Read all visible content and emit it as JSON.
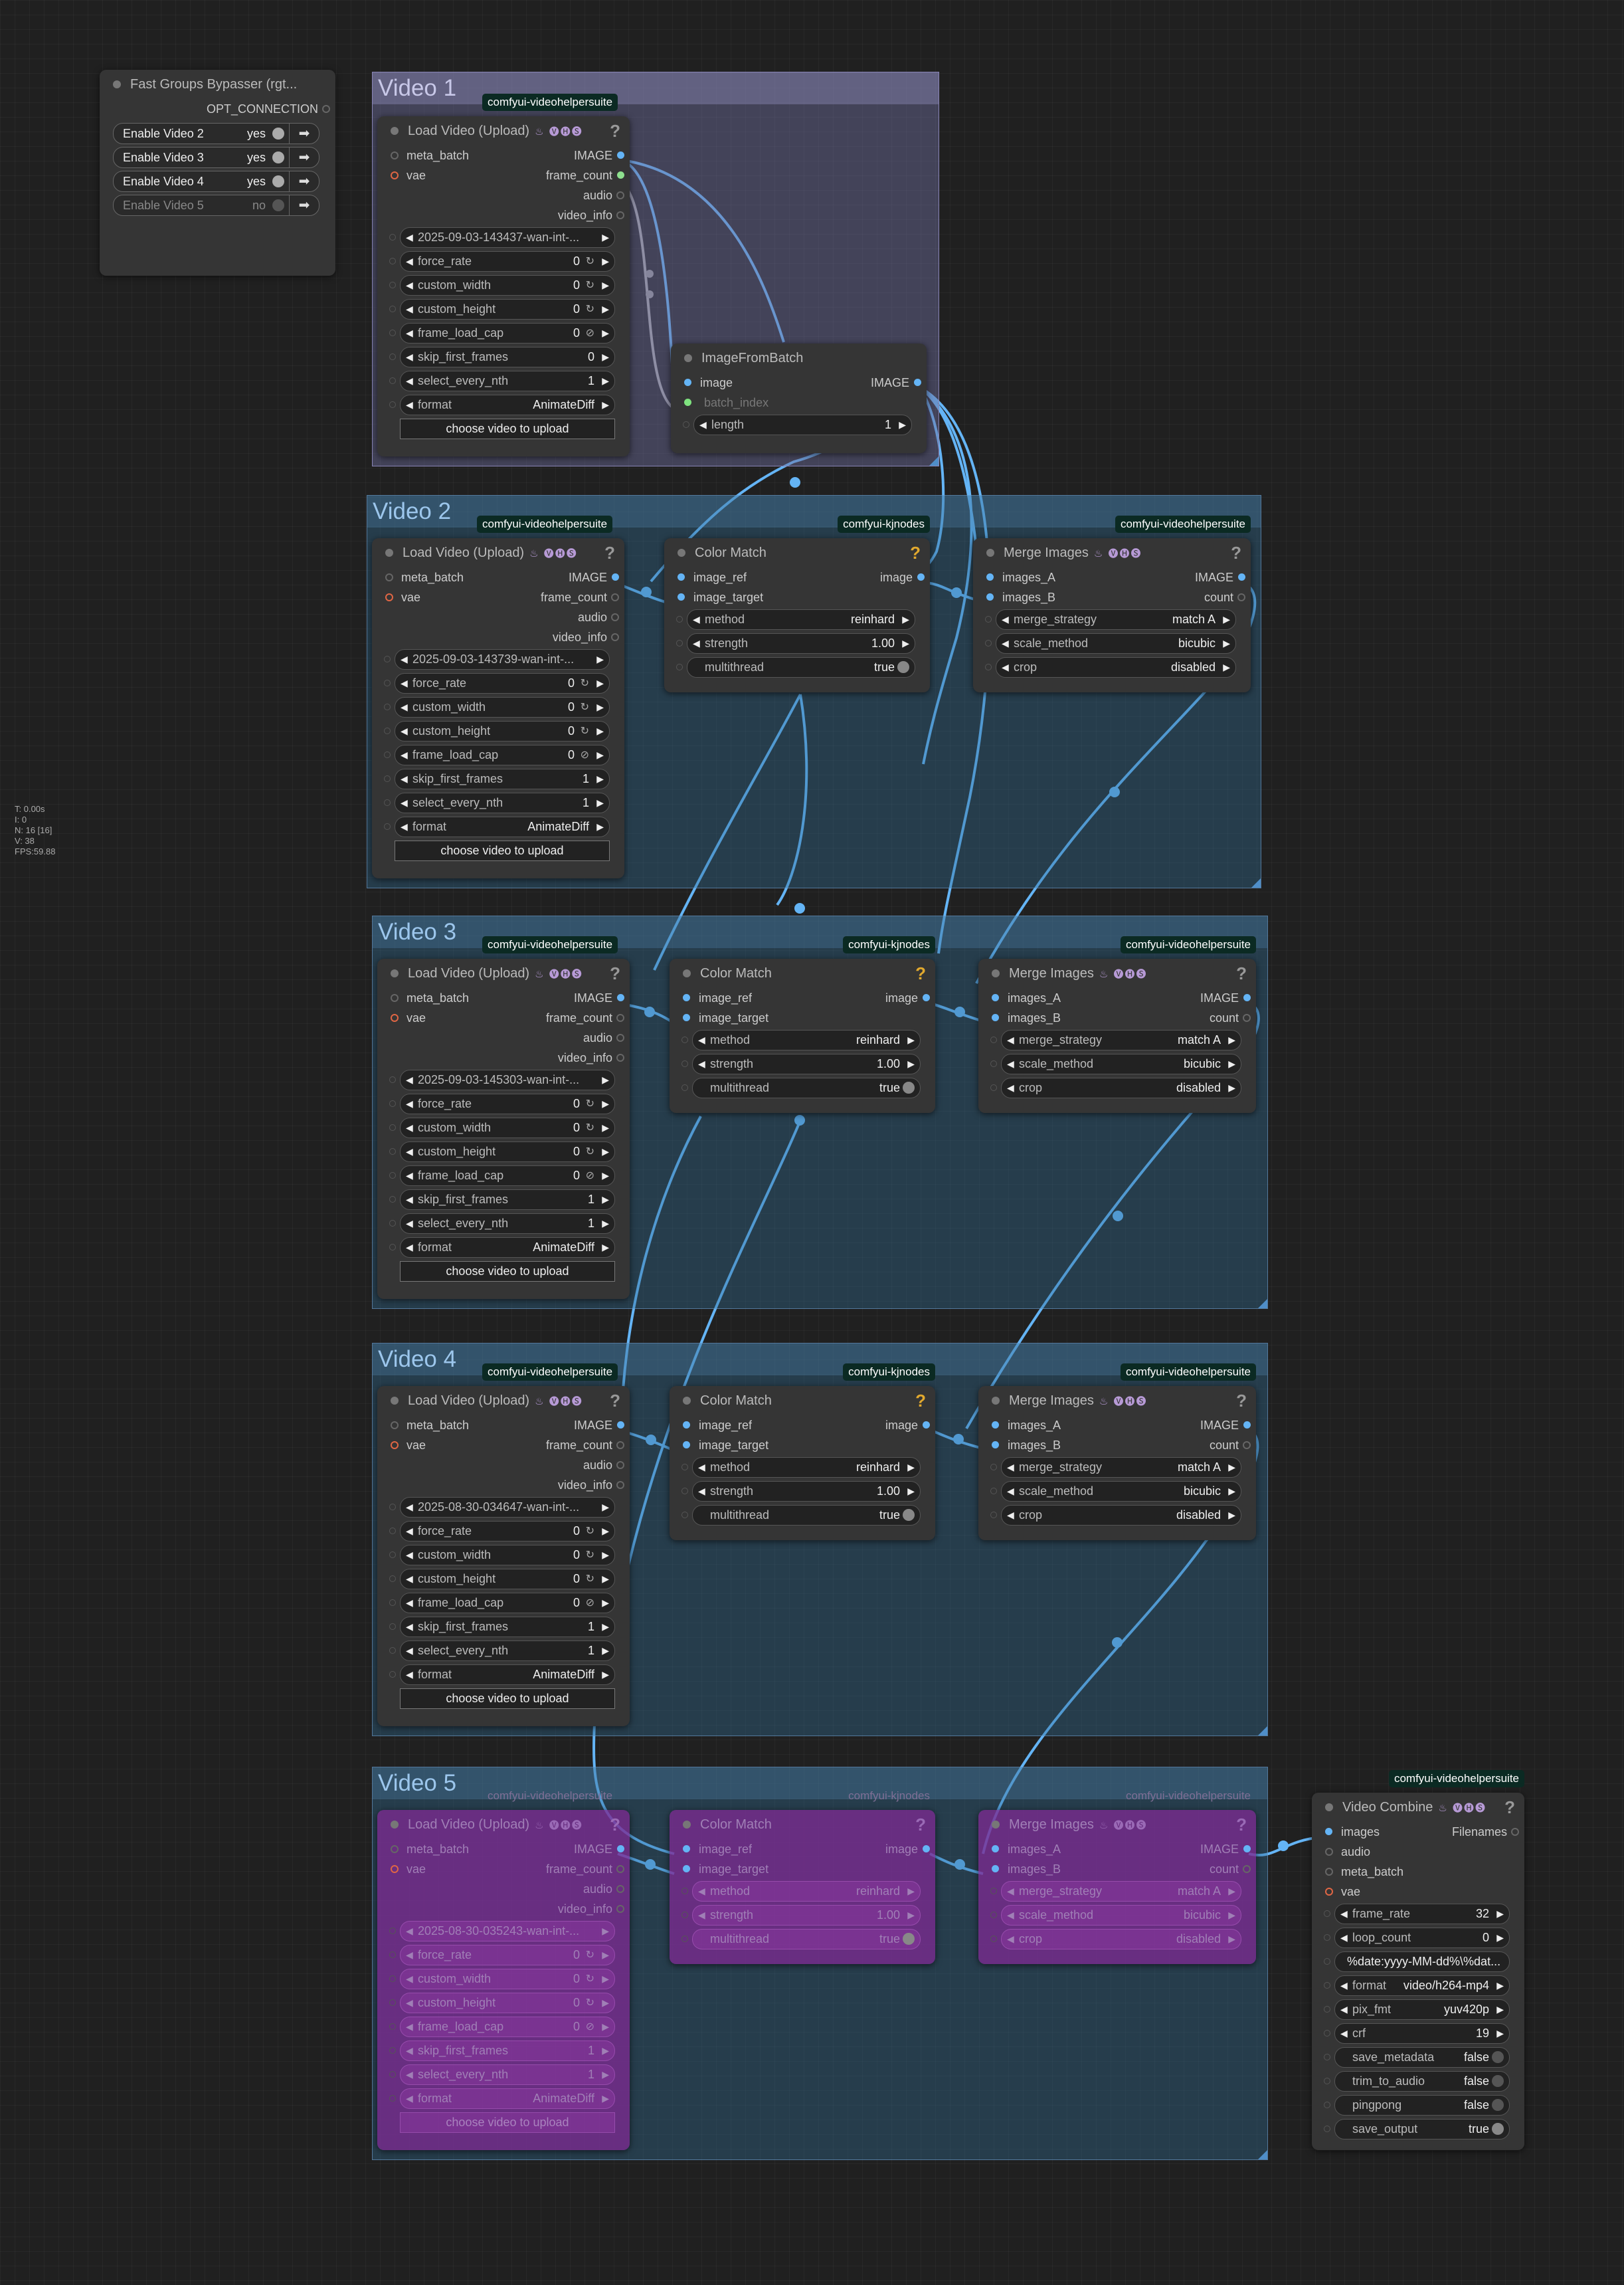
{
  "bypasser": {
    "title": "Fast Groups Bypasser (rgt...",
    "output": "OPT_CONNECTION",
    "rows": [
      {
        "label": "Enable Video 2",
        "value": "yes",
        "on": true
      },
      {
        "label": "Enable Video 3",
        "value": "yes",
        "on": true
      },
      {
        "label": "Enable Video 4",
        "value": "yes",
        "on": true
      },
      {
        "label": "Enable Video 5",
        "value": "no",
        "on": false
      }
    ]
  },
  "stats": [
    "T: 0.00s",
    "I: 0",
    "N: 16 [16]",
    "V: 38",
    "FPS:59.88"
  ],
  "common": {
    "vhs_tag": "comfyui-videohelpersuite",
    "kj_tag": "comfyui-kjnodes",
    "vhs_badge": "♨ 🅥🅗🅢",
    "help": "?",
    "load": {
      "title": "Load Video (Upload)",
      "inputs": [
        "meta_batch",
        "vae"
      ],
      "outputs": [
        "IMAGE",
        "frame_count",
        "audio",
        "video_info"
      ],
      "w_force_rate": "force_rate",
      "w_custom_width": "custom_width",
      "w_custom_height": "custom_height",
      "w_frame_load_cap": "frame_load_cap",
      "w_skip": "skip_first_frames",
      "w_nth": "select_every_nth",
      "w_format": "format",
      "format_value": "AnimateDiff",
      "zero": "0",
      "one": "1",
      "upload": "choose video to upload"
    },
    "cm": {
      "title": "Color Match",
      "in1": "image_ref",
      "in2": "image_target",
      "out": "image",
      "w_method": "method",
      "method": "reinhard",
      "w_strength": "strength",
      "strength": "1.00",
      "w_multithread": "multithread",
      "multithread": "true"
    },
    "mi": {
      "title": "Merge Images",
      "in1": "images_A",
      "in2": "images_B",
      "out1": "IMAGE",
      "out2": "count",
      "w_strategy": "merge_strategy",
      "strategy": "match A",
      "w_scale": "scale_method",
      "scale": "bicubic",
      "w_crop": "crop",
      "crop": "disabled"
    }
  },
  "groups": [
    {
      "title": "Video 1"
    },
    {
      "title": "Video 2"
    },
    {
      "title": "Video 3"
    },
    {
      "title": "Video 4"
    },
    {
      "title": "Video 5"
    }
  ],
  "videos": [
    {
      "file": "2025-09-03-143437-wan-int-...",
      "skip": "0"
    },
    {
      "file": "2025-09-03-143739-wan-int-...",
      "skip": "1"
    },
    {
      "file": "2025-09-03-145303-wan-int-...",
      "skip": "1"
    },
    {
      "file": "2025-08-30-034647-wan-int-...",
      "skip": "1"
    },
    {
      "file": "2025-08-30-035243-wan-int-...",
      "skip": "1"
    }
  ],
  "image_from_batch": {
    "title": "ImageFromBatch",
    "input": "image",
    "output": "IMAGE",
    "batch_index": "batch_index",
    "w_length": "length",
    "length": "1"
  },
  "video_combine": {
    "title": "Video Combine",
    "inputs": [
      "images",
      "audio",
      "meta_batch",
      "vae"
    ],
    "output": "Filenames",
    "frame_rate": {
      "name": "frame_rate",
      "value": "32"
    },
    "loop_count": {
      "name": "loop_count",
      "value": "0"
    },
    "filename_prefix": "%date:yyyy-MM-dd%\\%dat...",
    "format": {
      "name": "format",
      "value": "video/h264-mp4"
    },
    "pix_fmt": {
      "name": "pix_fmt",
      "value": "yuv420p"
    },
    "crf": {
      "name": "crf",
      "value": "19"
    },
    "save_metadata": {
      "name": "save_metadata",
      "value": "false"
    },
    "trim_to_audio": {
      "name": "trim_to_audio",
      "value": "false"
    },
    "pingpong": {
      "name": "pingpong",
      "value": "false"
    },
    "save_output": {
      "name": "save_output",
      "value": "true"
    }
  },
  "colors": {
    "link": "#64b4f5",
    "bypass": "#8a2a9c",
    "tag_bg": "#0b2a23",
    "help_orange": "#e2a92e"
  }
}
